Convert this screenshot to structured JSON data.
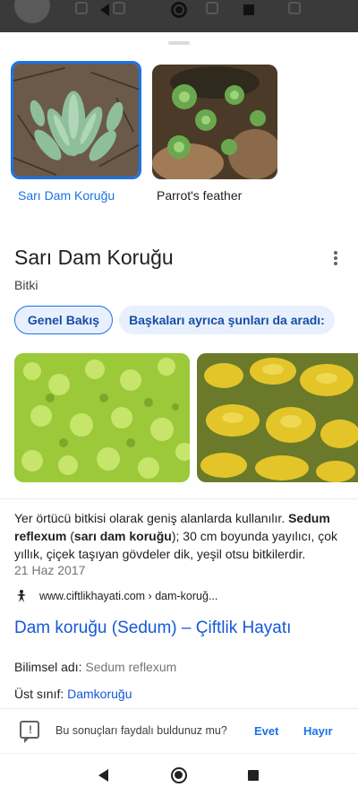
{
  "thumbnails": [
    {
      "label": "Sarı Dam Koruğu",
      "selected": true
    },
    {
      "label": "Parrot's feather",
      "selected": false
    }
  ],
  "entity": {
    "title": "Sarı Dam Koruğu",
    "subtitle": "Bitki"
  },
  "chips": [
    {
      "label": "Genel Bakış",
      "selected": true
    },
    {
      "label": "Başkaları ayrıca şunları da aradı:",
      "selected": false
    }
  ],
  "description": {
    "text_before": "Yer örtücü bitkisi olarak geniş alanlarda kullanılır. ",
    "bold_1": "Sedum reflexum",
    "text_mid": " (",
    "bold_2": "sarı dam koruğu",
    "text_after": "); 30 cm boyunda yayılıcı, çok yıllık, çiçek taşıyan gövdeler dik, yeşil otsu bitkilerdir.",
    "date": "21 Haz 2017"
  },
  "source": {
    "url": "www.ciftlikhayati.com › dam-koruğ...",
    "link_title": "Dam koruğu (Sedum) – Çiftlik Hayatı"
  },
  "facts": [
    {
      "key": "Bilimsel adı:",
      "value": "Sedum reflexum",
      "is_link": false
    },
    {
      "key": "Üst sınıf:",
      "value": "Damkoruğu",
      "is_link": true
    }
  ],
  "feedback": {
    "question": "Bu sonuçları faydalı buldunuz mu?",
    "yes": "Evet",
    "no": "Hayır"
  },
  "colors": {
    "accent": "#1a73e8",
    "link": "#1558d6",
    "chip_bg": "#e8f0fe"
  }
}
